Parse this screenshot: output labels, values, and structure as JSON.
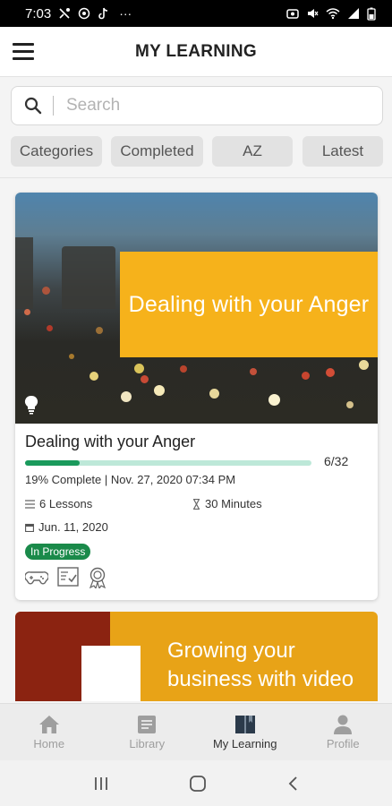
{
  "status_bar": {
    "time": "7:03",
    "overflow": "···",
    "icons_left": [
      "network-icon",
      "at-icon",
      "tiktok-icon"
    ],
    "icons_right": [
      "alarm-icon",
      "mute-icon",
      "wifi-icon",
      "signal-icon",
      "battery-icon"
    ]
  },
  "app_bar": {
    "title": "MY LEARNING"
  },
  "search": {
    "placeholder": "Search",
    "value": ""
  },
  "filters": [
    "Categories",
    "Completed",
    "AZ",
    "Latest"
  ],
  "course": {
    "banner_text": "Dealing with your Anger",
    "title": "Dealing with your Anger",
    "progress_count": "6/32",
    "progress_fraction": 0.19,
    "progress_text": "19% Complete | Nov. 27, 2020 07:34 PM",
    "lessons": "6 Lessons",
    "duration": "30 Minutes",
    "date": "Jun. 11, 2020",
    "status": "In Progress",
    "feature_icons": [
      "gamepad-icon",
      "quiz-icon",
      "certificate-icon"
    ]
  },
  "course2": {
    "banner_text": "Growing your business with video"
  },
  "bottom_nav": [
    {
      "label": "Home",
      "icon": "home-icon",
      "active": false
    },
    {
      "label": "Library",
      "icon": "library-icon",
      "active": false
    },
    {
      "label": "My Learning",
      "icon": "book-icon",
      "active": true
    },
    {
      "label": "Profile",
      "icon": "profile-icon",
      "active": false
    }
  ],
  "system_nav": [
    "recents-icon",
    "home-button-icon",
    "back-icon"
  ],
  "colors": {
    "accent_green": "#1a9a5c",
    "banner_orange": "#f6b21b",
    "track_green": "#bde8d8"
  }
}
